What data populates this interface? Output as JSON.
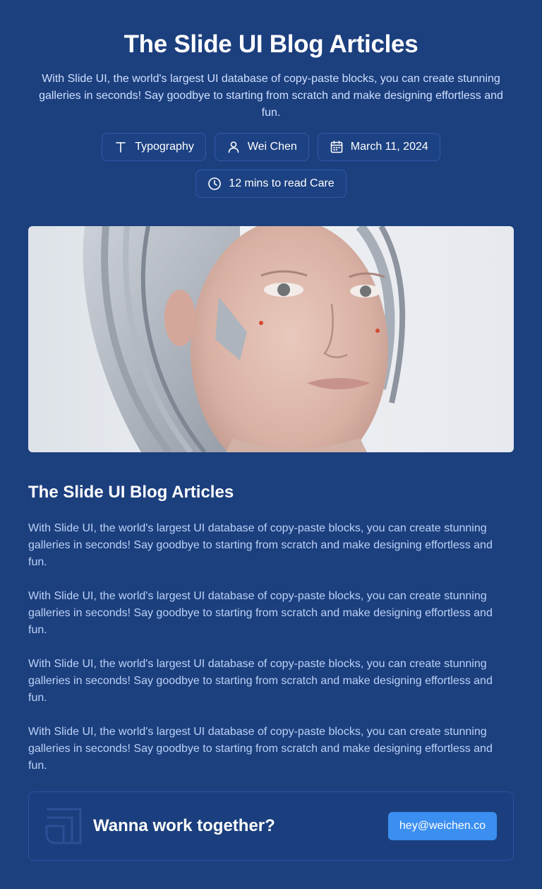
{
  "header": {
    "title": "The Slide UI Blog Articles",
    "subtitle": "With Slide UI, the world's largest UI database of copy-paste blocks, you can create stunning galleries in seconds! Say goodbye to starting from scratch and make designing effortless and fun."
  },
  "meta": {
    "category": "Typography",
    "author": "Wei Chen",
    "date": "March 11, 2024",
    "read_time": "12 mins to read Care"
  },
  "article": {
    "title": "The Slide UI Blog Articles",
    "paragraphs": [
      "With Slide UI, the world's largest UI database of copy-paste blocks, you can create stunning galleries in seconds! Say goodbye to starting from scratch and make designing effortless and fun.",
      "With Slide UI, the world's largest UI database of copy-paste blocks, you can create stunning galleries in seconds! Say goodbye to starting from scratch and make designing effortless and fun.",
      "With Slide UI, the world's largest UI database of copy-paste blocks, you can create stunning galleries in seconds! Say goodbye to starting from scratch and make designing effortless and fun.",
      "With Slide UI, the world's largest UI database of copy-paste blocks, you can create stunning galleries in seconds! Say goodbye to starting from scratch and make designing effortless and fun."
    ]
  },
  "cta": {
    "text": "Wanna work together?",
    "button_label": "hey@weichen.co"
  },
  "icons": {
    "category": "text-type-icon",
    "author": "user-icon",
    "date": "calendar-icon",
    "read_time": "clock-icon",
    "cta_logo": "brand-logo-icon"
  },
  "colors": {
    "background": "#1c3f7e",
    "chip_border": "#2f5aa6",
    "body_text": "#bcd2f7",
    "accent": "#3b8ff0"
  }
}
